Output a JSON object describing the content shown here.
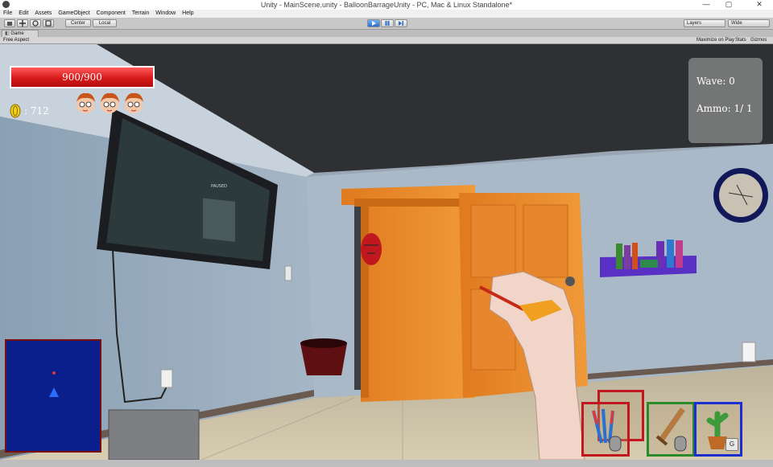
{
  "window": {
    "title": "Unity - MainScene.unity - BalloonBarrageUnity - PC, Mac & Linux Standalone*",
    "controls": [
      "—",
      "▢",
      "✕"
    ]
  },
  "menu": [
    "File",
    "Edit",
    "Assets",
    "GameObject",
    "Component",
    "Terrain",
    "Window",
    "Help"
  ],
  "toolbar": {
    "pivot_label": "Center",
    "space_label": "Local",
    "layers_label": "Layers",
    "layout_label": "Wide"
  },
  "game_tab": {
    "label": "Game",
    "aspect": "Free Aspect",
    "maximize": "Maximize on Play",
    "stats": "Stats",
    "gizmos": "Gizmos"
  },
  "hud": {
    "health_text": "900/900",
    "health_fraction": 1.0,
    "coins_text": ": 712",
    "lives": 3,
    "wave_text": "Wave: 0",
    "ammo_text": "Ammo: 1/ 1",
    "tv_pause_text": "PAUSED",
    "hotkey_label": "G"
  },
  "colors": {
    "health": "#d81a1a",
    "slot_darts": "#c0181e",
    "slot_sword": "#2a8a2a",
    "slot_cactus": "#1b2fd1",
    "minimap": "#0a1f8c"
  }
}
